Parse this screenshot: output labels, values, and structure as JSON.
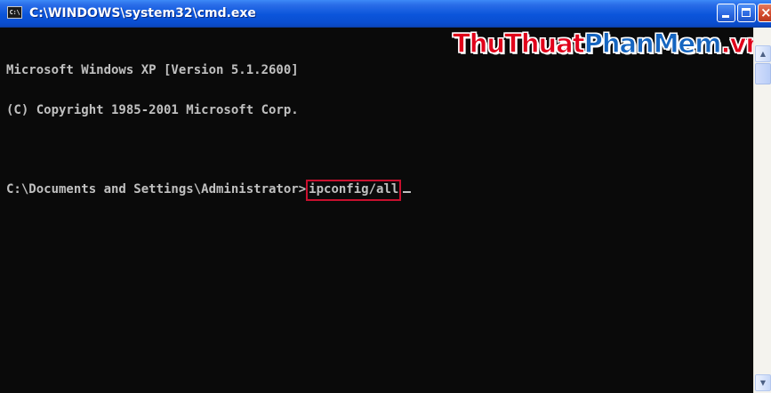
{
  "window": {
    "title": "C:\\WINDOWS\\system32\\cmd.exe",
    "icon_text": "C:\\",
    "icon": "cmd-icon"
  },
  "title_buttons": {
    "minimize": "minimize-icon",
    "maximize": "maximize-icon",
    "close": "close-icon",
    "close_glyph": "×"
  },
  "console": {
    "line1": "Microsoft Windows XP [Version 5.1.2600]",
    "line2": "(C) Copyright 1985-2001 Microsoft Corp.",
    "prompt": "C:\\Documents and Settings\\Administrator>",
    "command": "ipconfig/all"
  },
  "watermark": {
    "part1": "ThuThuat",
    "part2": "PhanMem",
    "part3": ".vn"
  },
  "scrollbar": {
    "up_glyph": "▲",
    "down_glyph": "▼"
  },
  "colors": {
    "console_bg": "#0A0A0A",
    "console_text": "#C0C0C0",
    "titlebar": "#0B55DB",
    "highlight_box": "#C8102E",
    "watermark_red": "#E0001A",
    "watermark_blue": "#1565C0"
  }
}
